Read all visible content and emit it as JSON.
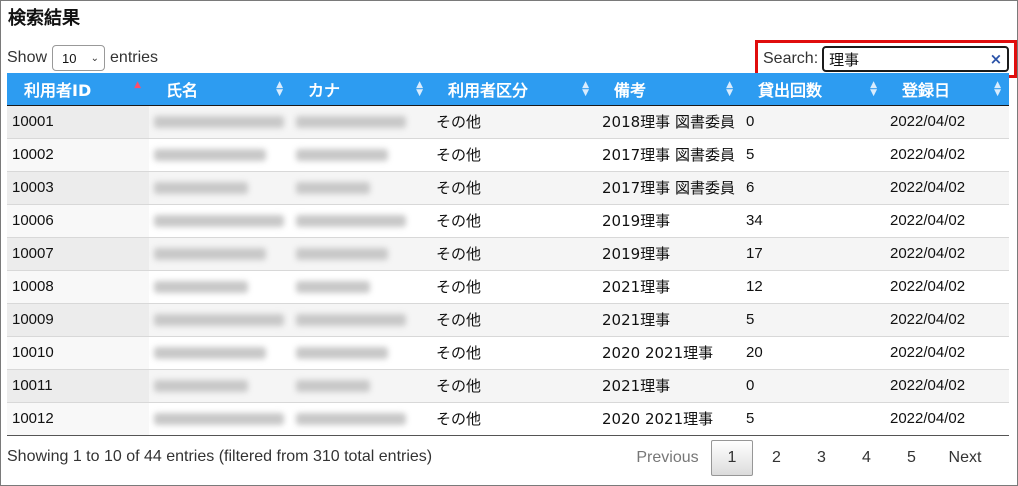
{
  "page": {
    "title": "検索結果"
  },
  "length_menu": {
    "show_label": "Show",
    "value": "10",
    "entries_label": "entries"
  },
  "search": {
    "label": "Search:",
    "value": "理事",
    "clear_icon": "×"
  },
  "table": {
    "columns": [
      "利用者ID",
      "氏名",
      "カナ",
      "利用者区分",
      "備考",
      "貸出回数",
      "登録日"
    ],
    "sorted_column": "利用者ID",
    "sort_direction": "asc",
    "rows": [
      {
        "id": "10001",
        "name": "",
        "kana": "",
        "category": "その他",
        "note": "2018理事 図書委員",
        "loans": "0",
        "date": "2022/04/02"
      },
      {
        "id": "10002",
        "name": "",
        "kana": "",
        "category": "その他",
        "note": "2017理事 図書委員",
        "loans": "5",
        "date": "2022/04/02"
      },
      {
        "id": "10003",
        "name": "",
        "kana": "",
        "category": "その他",
        "note": "2017理事 図書委員",
        "loans": "6",
        "date": "2022/04/02"
      },
      {
        "id": "10006",
        "name": "",
        "kana": "",
        "category": "その他",
        "note": "2019理事",
        "loans": "34",
        "date": "2022/04/02"
      },
      {
        "id": "10007",
        "name": "",
        "kana": "",
        "category": "その他",
        "note": "2019理事",
        "loans": "17",
        "date": "2022/04/02"
      },
      {
        "id": "10008",
        "name": "",
        "kana": "",
        "category": "その他",
        "note": "2021理事",
        "loans": "12",
        "date": "2022/04/02"
      },
      {
        "id": "10009",
        "name": "",
        "kana": "",
        "category": "その他",
        "note": "2021理事",
        "loans": "5",
        "date": "2022/04/02"
      },
      {
        "id": "10010",
        "name": "",
        "kana": "",
        "category": "その他",
        "note": "2020 2021理事",
        "loans": "20",
        "date": "2022/04/02"
      },
      {
        "id": "10011",
        "name": "",
        "kana": "",
        "category": "その他",
        "note": "2021理事",
        "loans": "0",
        "date": "2022/04/02"
      },
      {
        "id": "10012",
        "name": "",
        "kana": "",
        "category": "その他",
        "note": "2020 2021理事",
        "loans": "5",
        "date": "2022/04/02"
      }
    ]
  },
  "info": "Showing 1 to 10 of 44 entries (filtered from 310 total entries)",
  "pagination": {
    "previous": "Previous",
    "pages": [
      "1",
      "2",
      "3",
      "4",
      "5"
    ],
    "current": "1",
    "next": "Next"
  },
  "colors": {
    "header_bg": "#2d9cf1",
    "search_highlight": "#e00d0d",
    "sort_active": "#ff4d6d"
  }
}
